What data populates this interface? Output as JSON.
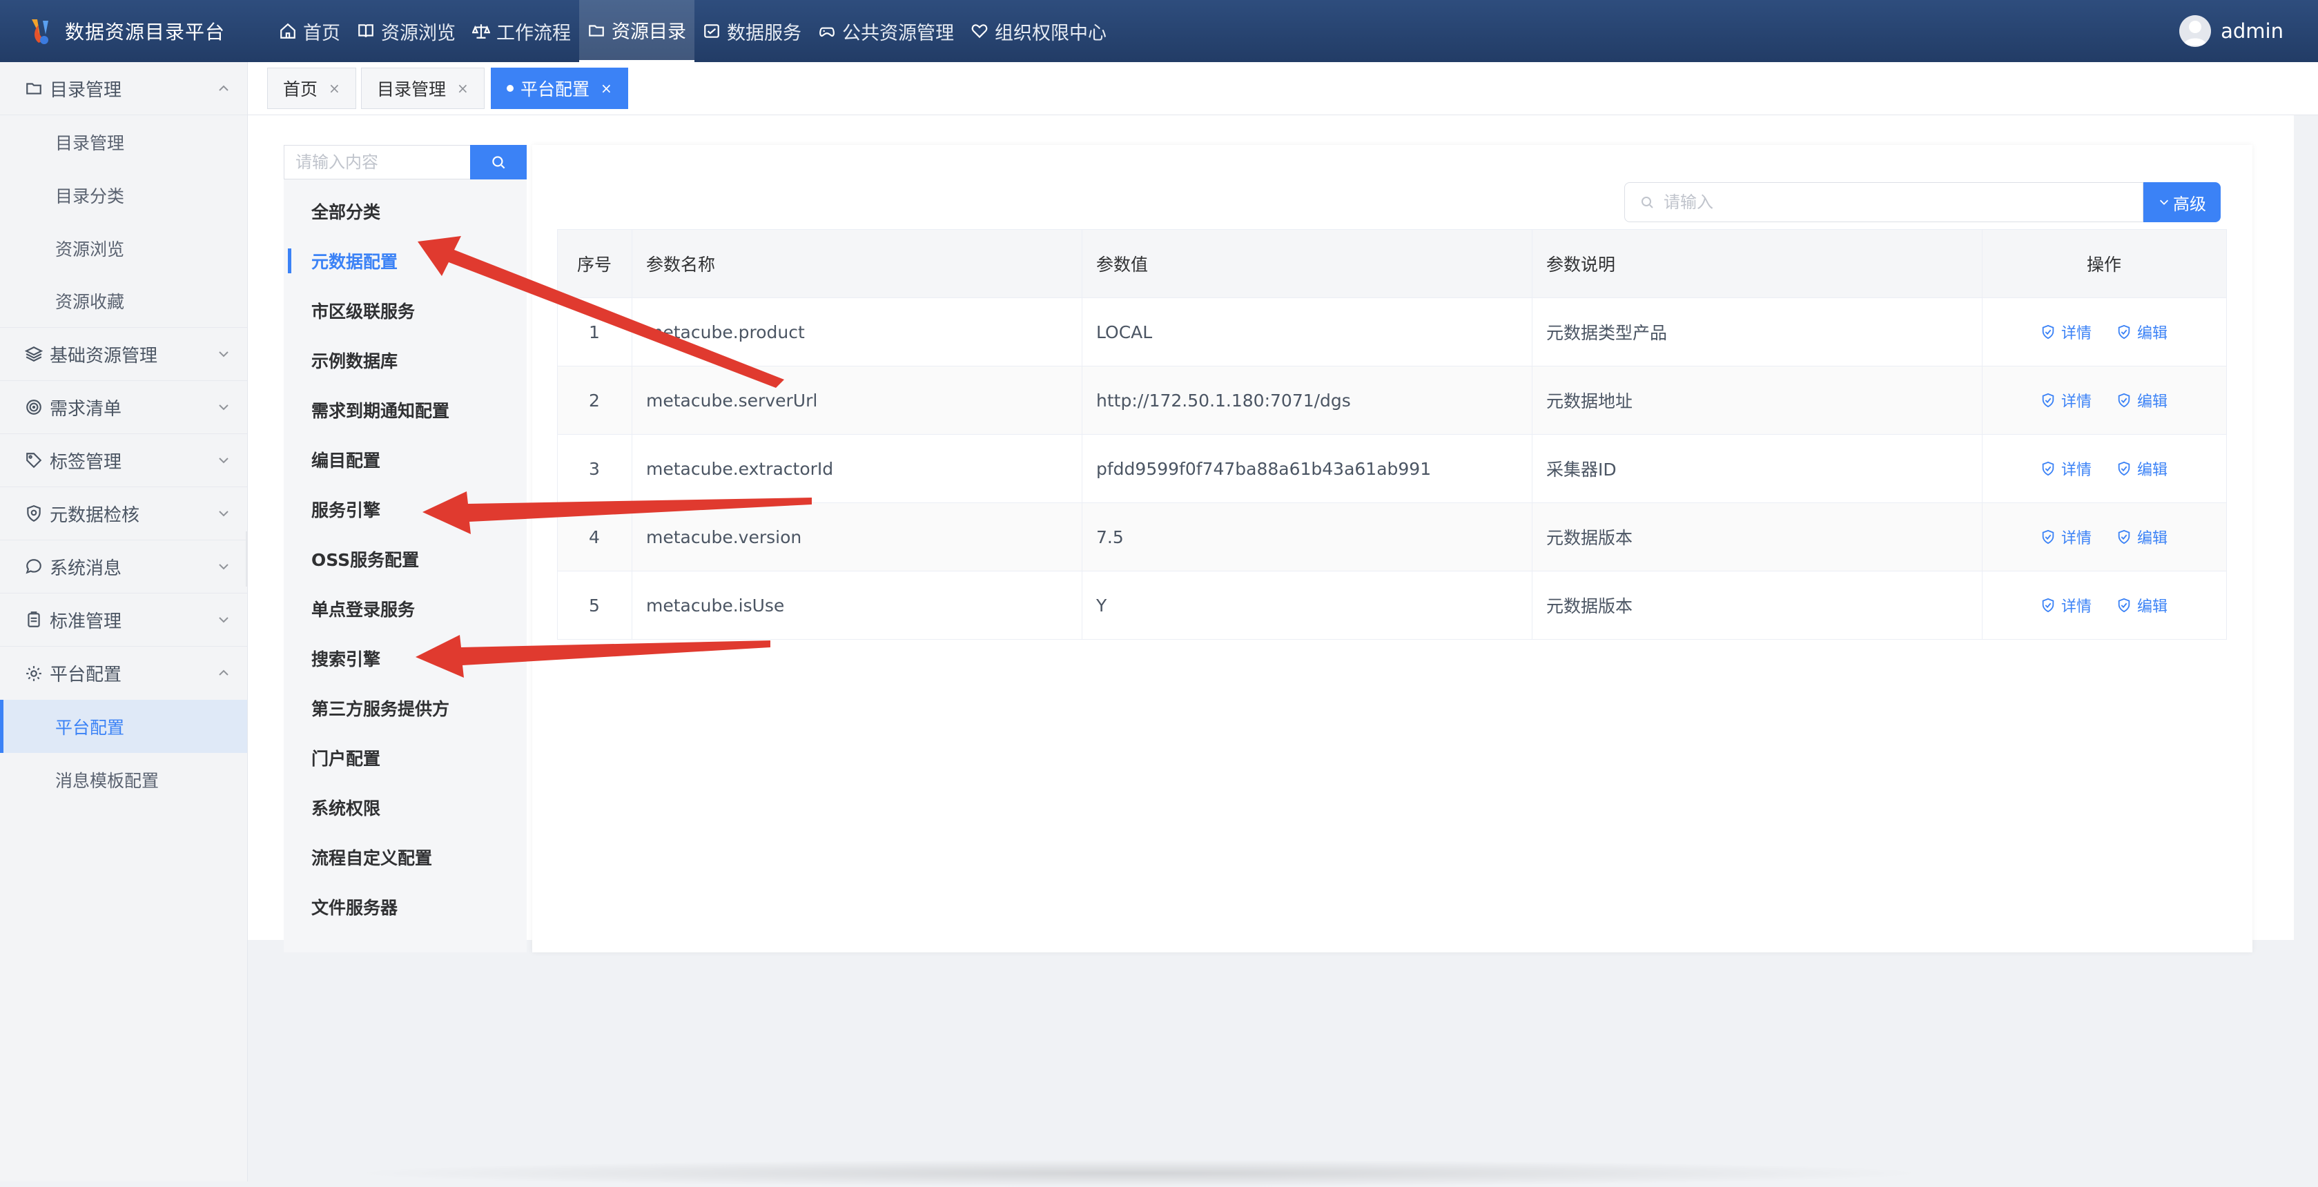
{
  "app": {
    "title": "数据资源目录平台"
  },
  "topnav": [
    {
      "label": "首页",
      "icon": "home-icon"
    },
    {
      "label": "资源浏览",
      "icon": "book-icon"
    },
    {
      "label": "工作流程",
      "icon": "scale-icon"
    },
    {
      "label": "资源目录",
      "icon": "folder-icon",
      "active": true
    },
    {
      "label": "数据服务",
      "icon": "service-icon"
    },
    {
      "label": "公共资源管理",
      "icon": "gamepad-icon"
    },
    {
      "label": "组织权限中心",
      "icon": "heart-icon"
    }
  ],
  "user": {
    "name": "admin"
  },
  "sidebar": {
    "groups": [
      {
        "label": "目录管理",
        "icon": "folder-icon",
        "expanded": true,
        "items": [
          {
            "label": "目录管理"
          },
          {
            "label": "目录分类"
          },
          {
            "label": "资源浏览"
          },
          {
            "label": "资源收藏"
          }
        ]
      },
      {
        "label": "基础资源管理",
        "icon": "layers-icon"
      },
      {
        "label": "需求清单",
        "icon": "radar-icon"
      },
      {
        "label": "标签管理",
        "icon": "tag-icon"
      },
      {
        "label": "元数据检核",
        "icon": "shield-icon"
      },
      {
        "label": "系统消息",
        "icon": "chat-icon"
      },
      {
        "label": "标准管理",
        "icon": "clipboard-icon"
      },
      {
        "label": "平台配置",
        "icon": "gear-icon",
        "expanded": true,
        "items": [
          {
            "label": "平台配置",
            "active": true
          },
          {
            "label": "消息模板配置"
          }
        ]
      }
    ]
  },
  "tabs": [
    {
      "label": "首页"
    },
    {
      "label": "目录管理"
    },
    {
      "label": "平台配置",
      "active": true
    }
  ],
  "tab_close": "×",
  "category_search": {
    "placeholder": "请输入内容"
  },
  "categories": [
    {
      "label": "全部分类"
    },
    {
      "label": "元数据配置",
      "active": true
    },
    {
      "label": "市区级联服务"
    },
    {
      "label": "示例数据库"
    },
    {
      "label": "需求到期通知配置"
    },
    {
      "label": "编目配置"
    },
    {
      "label": "服务引擎"
    },
    {
      "label": "OSS服务配置"
    },
    {
      "label": "单点登录服务"
    },
    {
      "label": "搜索引擎"
    },
    {
      "label": "第三方服务提供方"
    },
    {
      "label": "门户配置"
    },
    {
      "label": "系统权限"
    },
    {
      "label": "流程自定义配置"
    },
    {
      "label": "文件服务器"
    }
  ],
  "filter": {
    "placeholder": "请输入",
    "advanced_label": "高级"
  },
  "table": {
    "columns": {
      "no": "序号",
      "name": "参数名称",
      "value": "参数值",
      "desc": "参数说明",
      "ops": "操作"
    },
    "rows": [
      {
        "no": "1",
        "name": "metacube.product",
        "value": "LOCAL",
        "desc": "元数据类型产品"
      },
      {
        "no": "2",
        "name": "metacube.serverUrl",
        "value": "http://172.50.1.180:7071/dgs",
        "desc": "元数据地址"
      },
      {
        "no": "3",
        "name": "metacube.extractorId",
        "value": "pfdd9599f0f747ba88a61b43a61ab991",
        "desc": "采集器ID"
      },
      {
        "no": "4",
        "name": "metacube.version",
        "value": "7.5",
        "desc": "元数据版本"
      },
      {
        "no": "5",
        "name": "metacube.isUse",
        "value": "Y",
        "desc": "元数据版本"
      }
    ],
    "op_detail": "详情",
    "op_edit": "编辑"
  },
  "colors": {
    "primary": "#3b82f6",
    "header": "#2b4874",
    "annotation_arrow": "#e03a2f"
  }
}
